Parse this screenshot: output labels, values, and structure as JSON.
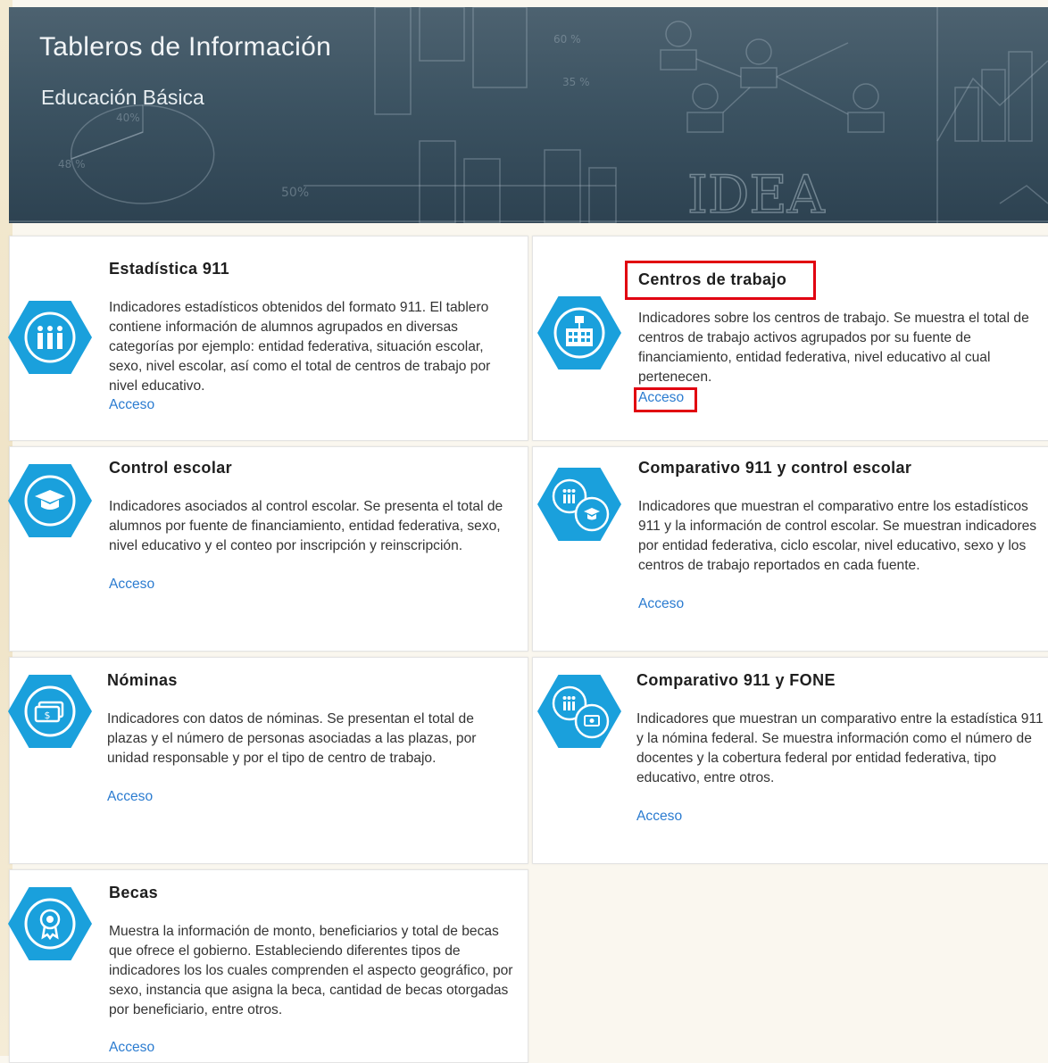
{
  "banner": {
    "title": "Tableros de Información",
    "subtitle": "Educación Básica"
  },
  "cards": [
    {
      "title": "Estadística 911",
      "icon": "students-icon",
      "description": "Indicadores estadísticos obtenidos del formato 911. El tablero contiene información de alumnos agrupados en diversas categorías por ejemplo: entidad federativa, situación escolar, sexo, nivel escolar, así como el total de centros de trabajo por nivel educativo.",
      "link": "Acceso"
    },
    {
      "title": "Centros de trabajo",
      "icon": "school-building-icon",
      "description": "Indicadores sobre los centros de trabajo. Se muestra el total de centros de trabajo activos agrupados por su fuente de financiamiento, entidad federativa, nivel educativo al cual pertenecen.",
      "link": "Acceso"
    },
    {
      "title": "Control escolar",
      "icon": "graduation-cap-icon",
      "description": "Indicadores asociados al control escolar. Se presenta el total de alumnos por fuente de financiamiento, entidad federativa, sexo, nivel educativo y el conteo por inscripción y reinscripción.",
      "link": "Acceso"
    },
    {
      "title": "Comparativo 911 y control escolar",
      "icon": "students-vs-graduation-icon",
      "description": "Indicadores que muestran el comparativo entre los estadísticos 911 y la información de control escolar. Se muestran indicadores por entidad federativa, ciclo escolar, nivel educativo, sexo y los centros de trabajo reportados en cada fuente.",
      "link": "Acceso"
    },
    {
      "title": "Nóminas",
      "icon": "money-icon",
      "description": "Indicadores con datos de nóminas. Se presentan el total de plazas y el número de personas asociadas a las plazas, por unidad responsable y por el tipo de centro de trabajo.",
      "link": "Acceso"
    },
    {
      "title": "Comparativo 911 y FONE",
      "icon": "students-vs-money-icon",
      "description": "Indicadores que muestran un comparativo entre la estadística 911 y la nómina federal. Se muestra información como el número de docentes y la cobertura federal por entidad federativa, tipo educativo, entre otros.",
      "link": "Acceso"
    },
    {
      "title": "Becas",
      "icon": "award-ribbon-icon",
      "description": "Muestra la información de monto, beneficiarios y total de becas que ofrece el gobierno. Estableciendo diferentes tipos de indicadores los los cuales comprenden el aspecto geográfico, por sexo, instancia que asigna la beca, cantidad de becas otorgadas por beneficiario, entre otros.",
      "link": "Acceso"
    }
  ],
  "colors": {
    "accent": "#1aa0dc",
    "link": "#2a7bd0",
    "highlight": "#e10010"
  }
}
